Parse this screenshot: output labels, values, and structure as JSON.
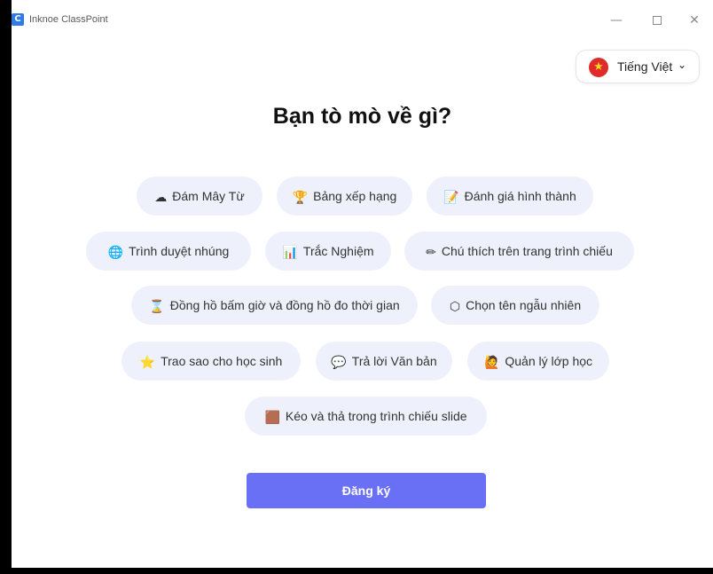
{
  "window": {
    "app_logo_letter": "C",
    "title": "Inknoe ClassPoint",
    "controls": {
      "minimize": "—",
      "close": "✕"
    }
  },
  "language": {
    "flag_symbol": "★",
    "label": "Tiếng Việt",
    "chevron": "⌄"
  },
  "heading": "Bạn tò mò về gì?",
  "topics": [
    {
      "icon": "cloud-icon",
      "glyph": "☁",
      "label": "Đám Mây Từ"
    },
    {
      "icon": "trophy-icon",
      "glyph": "🏆",
      "label": "Bảng xếp hạng"
    },
    {
      "icon": "memo-icon",
      "glyph": "📝",
      "label": "Đánh giá hình thành"
    },
    {
      "icon": "globe-icon",
      "glyph": "🌐",
      "label": "Trình duyệt nhúng"
    },
    {
      "icon": "bar-chart-icon",
      "glyph": "📊",
      "label": "Trắc Nghiệm"
    },
    {
      "icon": "pencil-icon",
      "glyph": "✏",
      "label": "Chú thích trên trang trình chiếu"
    },
    {
      "icon": "hourglass-icon",
      "glyph": "⌛",
      "label": "Đồng hồ bấm giờ và đồng hồ đo thời gian"
    },
    {
      "icon": "dice-icon",
      "glyph": "⬡",
      "label": "Chọn tên ngẫu nhiên"
    },
    {
      "icon": "star-icon",
      "glyph": "⭐",
      "label": "Trao sao cho học sinh"
    },
    {
      "icon": "speech-bubble-icon",
      "glyph": "💬",
      "label": "Trả lời Văn bản"
    },
    {
      "icon": "teacher-icon",
      "glyph": "🙋",
      "label": "Quản lý lớp học"
    },
    {
      "icon": "drag-drop-icon",
      "glyph": "🟫",
      "label": "Kéo và thả trong trình chiếu slide"
    }
  ],
  "signup_button": "Đăng ký",
  "colors": {
    "chip_background": "#eef1fb",
    "primary_button": "#6a70f5",
    "flag_red": "#e02b2b"
  }
}
